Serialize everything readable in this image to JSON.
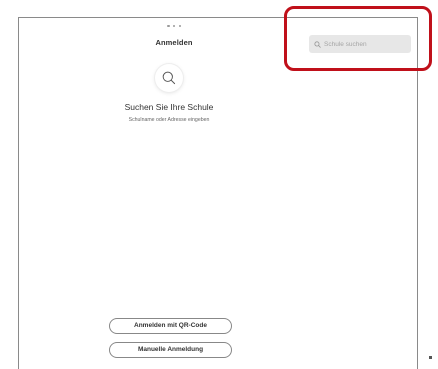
{
  "sheet": {
    "title": "Anmelden"
  },
  "search": {
    "placeholder": "Schule suchen",
    "icon": "search-icon"
  },
  "empty_state": {
    "icon": "search-icon",
    "heading": "Suchen Sie Ihre Schule",
    "subtext": "Schulname oder Adresse eingeben"
  },
  "actions": {
    "qr_label": "Anmelden mit QR-Code",
    "manual_label": "Manuelle Anmeldung"
  },
  "colors": {
    "annotation": "#c0101a",
    "search_field_bg": "#e7e7e7"
  }
}
